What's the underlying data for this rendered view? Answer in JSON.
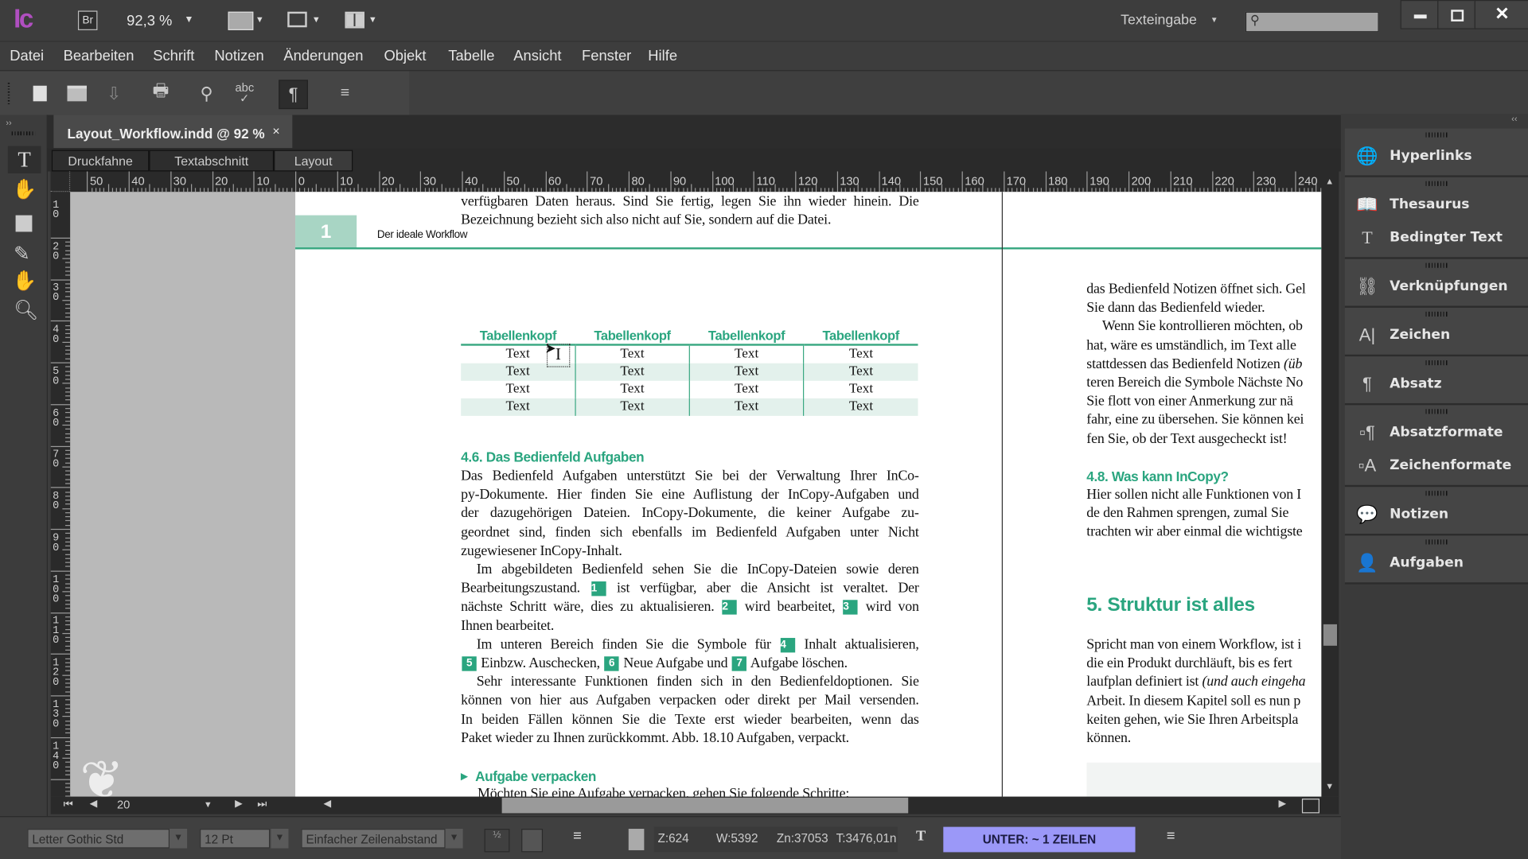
{
  "titlebar": {
    "app_logo": "Ic",
    "bridge": "Br",
    "zoom": "92,3 %",
    "workspace": "Texteingabe",
    "search_placeholder": ""
  },
  "menu": [
    "Datei",
    "Bearbeiten",
    "Schrift",
    "Notizen",
    "Änderungen",
    "Objekt",
    "Tabelle",
    "Ansicht",
    "Fenster",
    "Hilfe"
  ],
  "document_tab": {
    "title": "Layout_Workflow.indd @ 92 %",
    "close": "×"
  },
  "view_tabs": [
    "Druckfahne",
    "Textabschnitt",
    "Layout"
  ],
  "ruler": {
    "horizontal": [
      "50",
      "40",
      "30",
      "20",
      "10",
      "0",
      "10",
      "20",
      "30",
      "40",
      "50",
      "60",
      "70",
      "80",
      "90",
      "100",
      "110",
      "120",
      "130",
      "140",
      "150",
      "160",
      "170",
      "180",
      "190",
      "200",
      "210",
      "220",
      "230",
      "240"
    ],
    "vertical": [
      "10",
      "20",
      "30",
      "40",
      "50",
      "60",
      "70",
      "80",
      "90",
      "100",
      "110",
      "120",
      "130",
      "140"
    ]
  },
  "page": {
    "page_number": "1",
    "running_head": "Der ideale Workflow",
    "left_column": {
      "intro": [
        "verfügbaren Daten heraus. Sind Sie fertig, legen Sie ihn wieder hinein. Die",
        "Bezeichnung bezieht sich also nicht auf Sie, sondern auf die Datei."
      ],
      "table": {
        "headers": [
          "Tabellenkopf",
          "Tabellenkopf",
          "Tabellenkopf",
          "Tabellenkopf"
        ],
        "rows": [
          [
            "Text",
            "Text",
            "Text",
            "Text"
          ],
          [
            "Text",
            "Text",
            "Text",
            "Text"
          ],
          [
            "Text",
            "Text",
            "Text",
            "Text"
          ],
          [
            "Text",
            "Text",
            "Text",
            "Text"
          ]
        ]
      },
      "heading": "4.6.  Das Bedienfeld Aufgaben",
      "lines": [
        "Das Bedienfeld Aufgaben unterstützt Sie bei der Verwaltung Ihrer InCo-",
        "py-Dokumente. Hier finden Sie eine Auflistung der InCopy-Aufgaben und",
        "der dazugehörigen Dateien. InCopy-Dokumente, die keiner Aufgabe zu-",
        "geordnet sind, finden sich ebenfalls im Bedienfeld Aufgaben unter Nicht",
        "zugewiesener InCopy-Inhalt.",
        "Im abgebildeten Bedienfeld sehen Sie die InCopy-Dateien sowie deren",
        "Bearbeitungszustand. [1] ist verfügbar, aber die Ansicht ist veraltet. Der",
        "nächste Schritt wäre, dies zu aktualisieren. [2] wird bearbeitet, [3] wird von",
        "Ihnen bearbeitet.",
        "Im unteren Bereich finden Sie die Symbole für [4] Inhalt aktualisieren,",
        "[5] Einbzw. Auschecken, [6] Neue Aufgabe und [7] Aufgabe löschen.",
        "Sehr interessante Funktionen finden sich in den Bedienfeldoptionen. Sie",
        "können von hier aus Aufgaben verpacken oder direkt per Mail versenden.",
        "In beiden Fällen können Sie die Texte erst wieder bearbeiten, wenn das",
        "Paket wieder zu Ihnen zurückkommt. Abb. 18.10 Aufgaben, verpackt."
      ],
      "subheading": "Aufgabe verpacken",
      "last_line": "Möchten Sie eine Aufgabe verpacken, gehen Sie folgende Schritte:"
    },
    "right_column": {
      "lines_top": [
        "das Bedienfeld Notizen öffnet sich. Gel",
        "Sie dann das Bedienfeld wieder.",
        "Wenn Sie kontrollieren möchten, ob",
        "hat, wäre es umständlich, im Text alle",
        "stattdessen das Bedienfeld Notizen (üb",
        "teren Bereich die Symbole Nächste No",
        "Sie flott von einer Anmerkung zur nä",
        "fahr, eine zu übersehen. Sie können kei",
        "fen Sie, ob der Text ausgecheckt ist!"
      ],
      "heading_48": "4.8.  Was kann InCopy?",
      "lines_mid": [
        "Hier sollen nicht alle Funktionen von I",
        "de den Rahmen sprengen, zumal Sie",
        "trachten wir aber einmal die wichtigste"
      ],
      "heading_5": "5.  Struktur ist alles",
      "lines_bottom": [
        "Spricht man von einem Workflow, ist i",
        "die ein Produkt durchläuft, bis es fert",
        "laufplan definiert ist (und auch eingeha",
        "Arbeit. In diesem Kapitel soll es nun p",
        "keiten gehen, wie Sie Ihren Arbeitspla",
        "können."
      ]
    }
  },
  "page_nav": {
    "current_page": "20"
  },
  "statusbar": {
    "font": "Letter Gothic Std",
    "size": "12 Pt",
    "leading": "Einfacher Zeilenabstand",
    "z": "Z:624",
    "w": "W:5392",
    "zn": "Zn:37053",
    "t": "T:3476,01n",
    "overset": "UNTER:  ~ 1 ZEILEN"
  },
  "panels": [
    {
      "label": "Hyperlinks",
      "icon": "hyperlinks-icon"
    },
    {
      "label": "Thesaurus",
      "icon": "thesaurus-icon"
    },
    {
      "label": "Bedingter Text",
      "icon": "conditional-text-icon"
    },
    {
      "label": "Verknüpfungen",
      "icon": "links-icon"
    },
    {
      "label": "Zeichen",
      "icon": "character-icon"
    },
    {
      "label": "Absatz",
      "icon": "paragraph-icon"
    },
    {
      "label": "Absatzformate",
      "icon": "paragraph-styles-icon"
    },
    {
      "label": "Zeichenformate",
      "icon": "character-styles-icon"
    },
    {
      "label": "Notizen",
      "icon": "notes-icon"
    },
    {
      "label": "Aufgaben",
      "icon": "assignments-icon"
    }
  ],
  "colors": {
    "accent_green": "#2aa57f",
    "page_tab_green": "#a8d5c4",
    "overset_purple": "#9b98f8",
    "app_logo": "#b04fc0"
  }
}
